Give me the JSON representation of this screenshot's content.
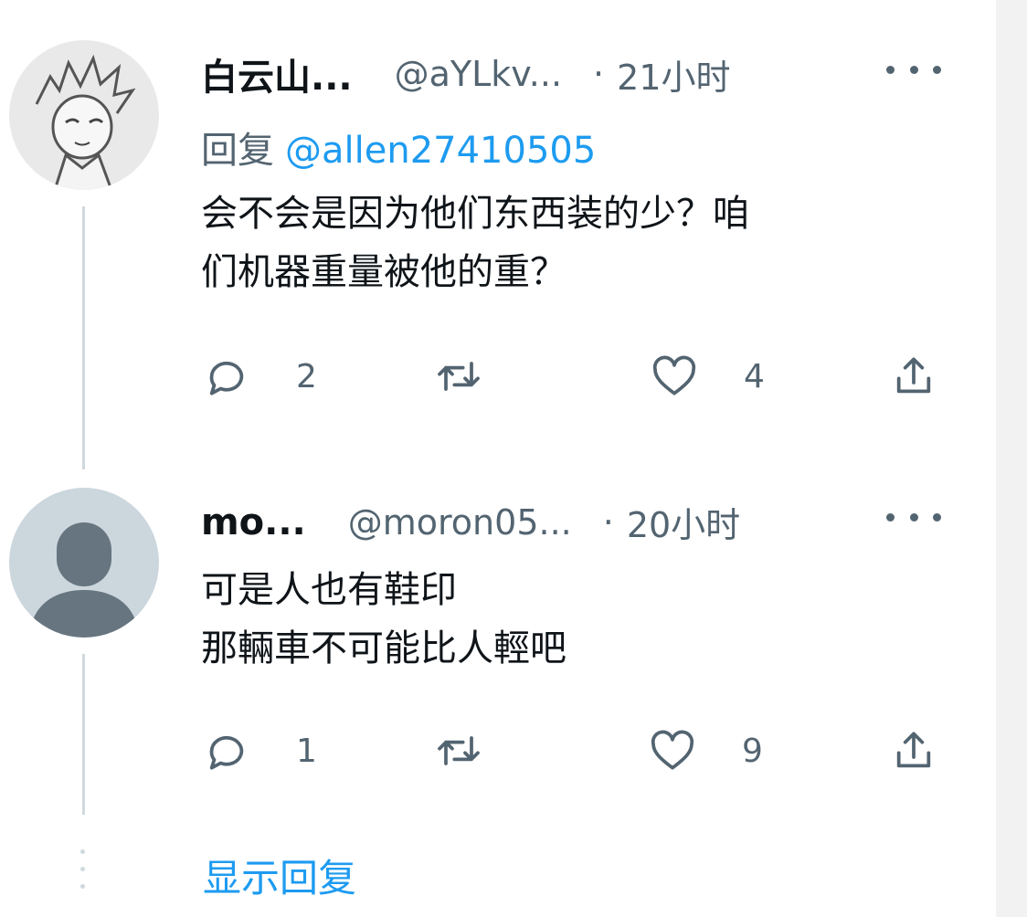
{
  "tweets": [
    {
      "name": "白云山...",
      "handle": "@aYLkv...",
      "dot": "·",
      "time": "21小时",
      "reply_label": "回复",
      "reply_mention": "@allen27410505",
      "text_lines": [
        "会不会是因为他们东西装的少？咱",
        "们机器重量被他的重？"
      ],
      "replies": "2",
      "retweets": "",
      "likes": "4",
      "avatar": "sketch-character-avatar"
    },
    {
      "name": "mo...",
      "handle": "@moron05...",
      "dot": "·",
      "time": "20小时",
      "text_lines": [
        "可是人也有鞋印",
        "那輛車不可能比人輕吧"
      ],
      "replies": "1",
      "retweets": "",
      "likes": "9",
      "avatar": "default-profile-avatar"
    }
  ],
  "show_replies": "显示回复",
  "icons": {
    "reply": "reply-icon",
    "retweet": "retweet-icon",
    "like": "heart-icon",
    "share": "share-icon",
    "more": "more-icon"
  },
  "colors": {
    "accent": "#1d9bf0",
    "secondary_text": "#536471",
    "primary_text": "#0f1419",
    "thread_line": "#cfd9de"
  }
}
